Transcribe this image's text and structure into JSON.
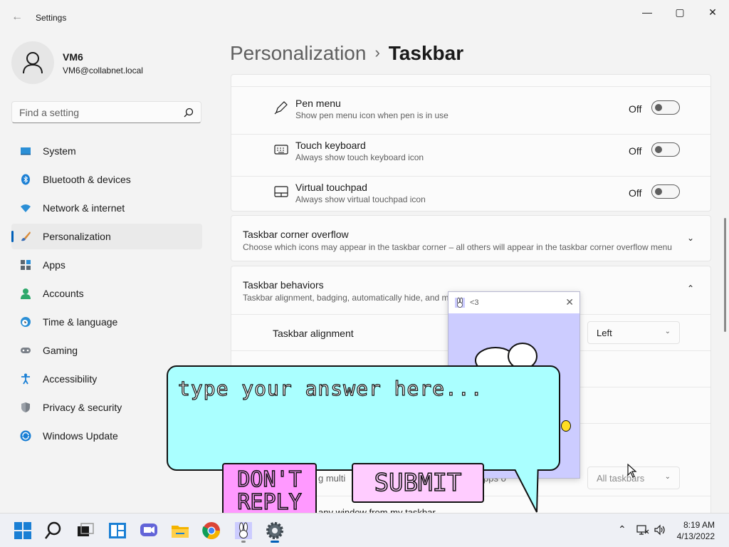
{
  "window": {
    "title": "Settings",
    "back": "←",
    "minimize": "—",
    "maximize": "▢",
    "close": "✕"
  },
  "profile": {
    "name": "VM6",
    "email": "VM6@collabnet.local"
  },
  "search": {
    "placeholder": "Find a setting"
  },
  "nav": {
    "items": [
      {
        "label": "System",
        "icon": "monitor-icon",
        "active": false
      },
      {
        "label": "Bluetooth & devices",
        "icon": "bluetooth-icon",
        "active": false
      },
      {
        "label": "Network & internet",
        "icon": "wifi-icon",
        "active": false
      },
      {
        "label": "Personalization",
        "icon": "brush-icon",
        "active": true
      },
      {
        "label": "Apps",
        "icon": "apps-icon",
        "active": false
      },
      {
        "label": "Accounts",
        "icon": "person-icon",
        "active": false
      },
      {
        "label": "Time & language",
        "icon": "clock-globe-icon",
        "active": false
      },
      {
        "label": "Gaming",
        "icon": "gamepad-icon",
        "active": false
      },
      {
        "label": "Accessibility",
        "icon": "accessibility-icon",
        "active": false
      },
      {
        "label": "Privacy & security",
        "icon": "shield-icon",
        "active": false
      },
      {
        "label": "Windows Update",
        "icon": "update-icon",
        "active": false
      }
    ]
  },
  "breadcrumb": {
    "parent": "Personalization",
    "separator": "›",
    "current": "Taskbar"
  },
  "corner_icons": [
    {
      "title": "Pen menu",
      "subtitle": "Show pen menu icon when pen is in use",
      "state": "Off"
    },
    {
      "title": "Touch keyboard",
      "subtitle": "Always show touch keyboard icon",
      "state": "Off"
    },
    {
      "title": "Virtual touchpad",
      "subtitle": "Always show virtual touchpad icon",
      "state": "Off"
    }
  ],
  "overflow": {
    "title": "Taskbar corner overflow",
    "subtitle": "Choose which icons may appear in the taskbar corner – all others will appear in the taskbar corner overflow menu"
  },
  "behaviors": {
    "title": "Taskbar behaviors",
    "subtitle": "Taskbar alignment, badging, automatically hide, and m",
    "alignment_label": "Taskbar alignment",
    "alignment_value": "Left",
    "partial_row_1": "g multi",
    "partial_row_1b": "pps o",
    "taskbars_value": "All taskbars",
    "partial_row_2": "any window from my taskbar"
  },
  "popup": {
    "title": "<3",
    "close": "✕"
  },
  "bubble": {
    "placeholder": "type your answer here...",
    "dont_reply": "DON'T REPLY",
    "submit": "SUBMIT"
  },
  "taskbar": {
    "time": "8:19 AM",
    "date": "4/13/2022",
    "apps": [
      "start-icon",
      "search-icon",
      "task-view-icon",
      "widgets-icon",
      "chat-icon",
      "file-explorer-icon",
      "chrome-icon",
      "bunny-app-icon",
      "settings-icon"
    ]
  }
}
